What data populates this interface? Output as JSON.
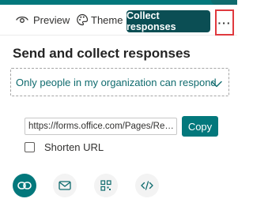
{
  "toolbar": {
    "preview_label": "Preview",
    "theme_label": "Theme",
    "collect_label": "Collect responses",
    "more_label": "···"
  },
  "panel": {
    "title": "Send and collect responses",
    "audience_selected": "Only people in my organization can respond",
    "url_value": "https://forms.office.com/Pages/ResponsePage.aspx",
    "copy_label": "Copy",
    "shorten_label": "Shorten URL",
    "shorten_checked": false
  },
  "share_options": [
    {
      "icon": "link-icon",
      "active": true
    },
    {
      "icon": "email-icon",
      "active": false
    },
    {
      "icon": "qr-code-icon",
      "active": false
    },
    {
      "icon": "embed-code-icon",
      "active": false
    }
  ],
  "colors": {
    "accent": "#03787c",
    "accent_dark": "#0b4e54",
    "highlight_border": "#e0393e"
  }
}
